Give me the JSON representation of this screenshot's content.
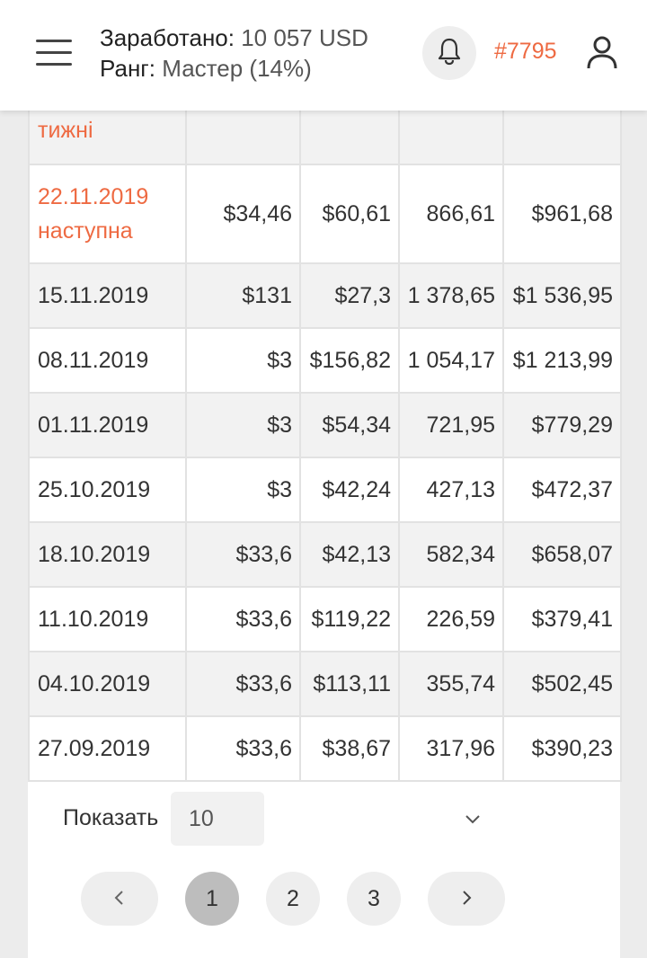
{
  "header": {
    "earned_label": "Заработано:",
    "earned_value": "10 057 USD",
    "rank_label": "Ранг:",
    "rank_value": "Мастер (14%)",
    "user_id": "#7795"
  },
  "table": {
    "partial_row_label": "тижні",
    "next_row": {
      "date": "22.11.2019",
      "note": "наступна",
      "c1": "$34,46",
      "c2": "$60,61",
      "c3": "866,61",
      "c4": "$961,68"
    },
    "rows": [
      {
        "date": "15.11.2019",
        "c1": "$131",
        "c2": "$27,3",
        "c3": "1 378,65",
        "c4": "$1 536,95"
      },
      {
        "date": "08.11.2019",
        "c1": "$3",
        "c2": "$156,82",
        "c3": "1 054,17",
        "c4": "$1 213,99"
      },
      {
        "date": "01.11.2019",
        "c1": "$3",
        "c2": "$54,34",
        "c3": "721,95",
        "c4": "$779,29"
      },
      {
        "date": "25.10.2019",
        "c1": "$3",
        "c2": "$42,24",
        "c3": "427,13",
        "c4": "$472,37"
      },
      {
        "date": "18.10.2019",
        "c1": "$33,6",
        "c2": "$42,13",
        "c3": "582,34",
        "c4": "$658,07"
      },
      {
        "date": "11.10.2019",
        "c1": "$33,6",
        "c2": "$119,22",
        "c3": "226,59",
        "c4": "$379,41"
      },
      {
        "date": "04.10.2019",
        "c1": "$33,6",
        "c2": "$113,11",
        "c3": "355,74",
        "c4": "$502,45"
      },
      {
        "date": "27.09.2019",
        "c1": "$33,6",
        "c2": "$38,67",
        "c3": "317,96",
        "c4": "$390,23"
      }
    ]
  },
  "pager": {
    "show_label": "Показать",
    "page_size": "10",
    "pages": [
      "1",
      "2",
      "3"
    ],
    "current": "1"
  },
  "icons": {
    "menu": "menu-icon",
    "bell": "bell-icon",
    "user": "user-icon",
    "chevron_down": "chevron-down-icon",
    "prev": "chevron-left-icon",
    "next": "chevron-right-icon"
  },
  "colors": {
    "accent": "#ee6a42",
    "active_page": "#bdbdbd"
  }
}
